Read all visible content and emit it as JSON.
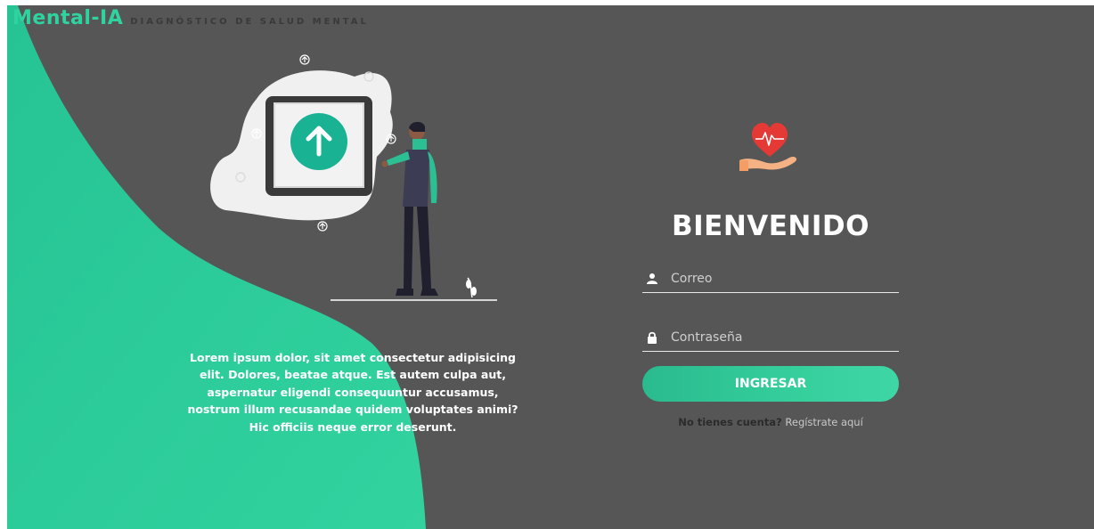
{
  "header": {
    "brand": "Mental-IA",
    "tagline": "DIAGNÓSTICO DE SALUD MENTAL"
  },
  "hero": {
    "description": "Lorem ipsum dolor, sit amet consectetur adipisicing elit. Dolores, beatae atque. Est autem culpa aut, aspernatur eligendi consequuntur accusamus, nostrum illum recusandae quidem voluptates animi? Hic officiis neque error deserunt."
  },
  "login": {
    "icon": "heart-in-hand-icon",
    "welcome": "BIENVENIDO",
    "email_placeholder": "Correo",
    "password_placeholder": "Contraseña",
    "submit_label": "INGRESAR",
    "register_question": "No tienes cuenta?",
    "register_link": "Regístrate aquí"
  },
  "colors": {
    "accent": "#2ed3a0",
    "background": "#565656",
    "heart": "#e53935"
  }
}
